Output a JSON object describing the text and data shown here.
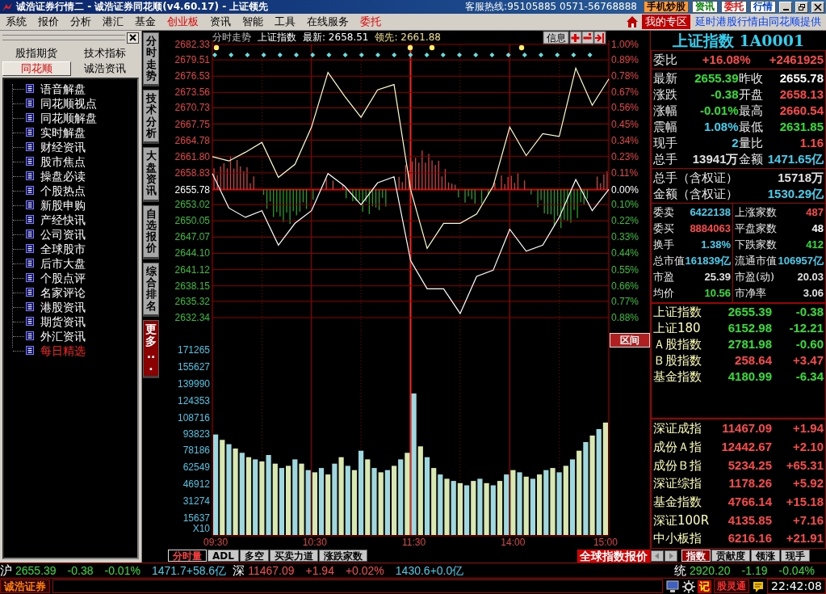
{
  "title_bar": {
    "title": "诚浩证券行情二 - 诚浩证券同花顺(v4.60.17) - 上证领先",
    "hotline": "客服热线:95105885 0571-56768888",
    "buttons": [
      {
        "label": "手机炒股",
        "kind": "filled",
        "color": "#ff9933"
      },
      {
        "label": "资讯",
        "kind": "outline",
        "color": "#008000"
      },
      {
        "label": "委托",
        "kind": "outline",
        "color": "#e00000"
      },
      {
        "label": "行情",
        "kind": "outline",
        "color": "#0040c0"
      }
    ]
  },
  "menu": {
    "items": [
      {
        "label": "系统",
        "highlighted": false
      },
      {
        "label": "报价",
        "highlighted": false
      },
      {
        "label": "分析",
        "highlighted": false
      },
      {
        "label": "港汇",
        "highlighted": false
      },
      {
        "label": "基金",
        "highlighted": false
      },
      {
        "label": "创业板",
        "highlighted": true
      },
      {
        "label": "资讯",
        "highlighted": false
      },
      {
        "label": "智能",
        "highlighted": false
      },
      {
        "label": "工具",
        "highlighted": false
      },
      {
        "label": "在线服务",
        "highlighted": false
      },
      {
        "label": "委托",
        "highlighted": true
      }
    ],
    "my_zone": "我的专区",
    "notice": "延时港股行情由同花顺提供"
  },
  "left_panel": {
    "tabs": [
      {
        "label": "股指期货",
        "selected": false
      },
      {
        "label": "技术指标",
        "selected": false
      },
      {
        "label": "同花顺",
        "selected": true
      },
      {
        "label": "诚浩资讯",
        "selected": false
      }
    ],
    "tree": [
      {
        "label": "语音解盘",
        "highlighted": false
      },
      {
        "label": "同花顺视点",
        "highlighted": false
      },
      {
        "label": "同花顺解盘",
        "highlighted": false
      },
      {
        "label": "实时解盘",
        "highlighted": false
      },
      {
        "label": "财经资讯",
        "highlighted": false
      },
      {
        "label": "股市焦点",
        "highlighted": false
      },
      {
        "label": "操盘必读",
        "highlighted": false
      },
      {
        "label": "个股热点",
        "highlighted": false
      },
      {
        "label": "新股申购",
        "highlighted": false
      },
      {
        "label": "产经快讯",
        "highlighted": false
      },
      {
        "label": "公司资讯",
        "highlighted": false
      },
      {
        "label": "全球股市",
        "highlighted": false
      },
      {
        "label": "后市大盘",
        "highlighted": false
      },
      {
        "label": "个股点评",
        "highlighted": false
      },
      {
        "label": "名家评论",
        "highlighted": false
      },
      {
        "label": "港股资讯",
        "highlighted": false
      },
      {
        "label": "期货资讯",
        "highlighted": false
      },
      {
        "label": "外汇资讯",
        "highlighted": false
      },
      {
        "label": "每日精选",
        "highlighted": true
      }
    ]
  },
  "side_tabs": [
    {
      "label": "分时走势",
      "highlighted": false
    },
    {
      "label": "技术分析",
      "highlighted": false
    },
    {
      "label": "大盘资讯",
      "highlighted": false
    },
    {
      "label": "自选报价",
      "highlighted": false
    },
    {
      "label": "综合排名",
      "highlighted": false
    },
    {
      "label": "更多...",
      "highlighted": true
    }
  ],
  "price_chart": {
    "header": {
      "view": "分时走势",
      "name": "上证指数",
      "latest": "最新: 2658.51",
      "lead": "领先: 2661.88"
    },
    "info_button": "信息",
    "baseline": "2655.78",
    "right_axis_labels": [
      "1.00%",
      "0.89%",
      "0.78%",
      "0.67%",
      "0.56%",
      "0.45%",
      "0.34%",
      "0.23%",
      "0.11%",
      "0.00%",
      "0.10%",
      "0.22%",
      "0.33%",
      "0.44%",
      "0.55%",
      "0.66%",
      "0.77%",
      "0.88%"
    ],
    "chart_data": {
      "type": "line",
      "grid": true,
      "categories": [
        null,
        null,
        null,
        null,
        null,
        null,
        null,
        null,
        null,
        null,
        null,
        null,
        null,
        null,
        null,
        null,
        null,
        null,
        null,
        null,
        null,
        null,
        null,
        null,
        null
      ],
      "ylim": [
        2632.34,
        2682.33
      ],
      "series": [
        {
          "color": "#ffffc8",
          "values": [
            2661.8,
            2661.0,
            2662.6,
            2664.4,
            2658.0,
            2660.4,
            2667.2,
            2677.2,
            2672.9,
            2669.0,
            2674.0,
            2675.0,
            2655.8,
            2645.0,
            2649.6,
            2649.6,
            2651.3,
            2656.4,
            2667.2,
            2662.0,
            2666.0,
            2665.5,
            2678.0,
            2671.2,
            2676.0
          ]
        },
        {
          "color": "#ffffff",
          "values": [
            2658.7,
            2652.4,
            2650.7,
            2651.9,
            2645.6,
            2649.6,
            2651.9,
            2658.7,
            2656.4,
            2653.0,
            2657.0,
            2658.1,
            2642.8,
            2637.6,
            2637.6,
            2633.1,
            2639.9,
            2641.0,
            2648.5,
            2644.5,
            2645.6,
            2650.7,
            2657.6,
            2651.9,
            2655.8
          ]
        }
      ],
      "yticks": [
        {
          "value": 2682.33,
          "label": "2682.33"
        },
        {
          "value": 2679.51,
          "label": "2679.51"
        },
        {
          "value": 2676.53,
          "label": "2676.53"
        },
        {
          "value": 2673.56,
          "label": "2673.56"
        },
        {
          "value": 2670.73,
          "label": "2670.73"
        },
        {
          "value": 2667.75,
          "label": "2667.75"
        },
        {
          "value": 2664.78,
          "label": "2664.78"
        },
        {
          "value": 2661.8,
          "label": "2661.80"
        },
        {
          "value": 2658.83,
          "label": "2658.83"
        },
        {
          "value": 2653.02,
          "label": "2653.02"
        },
        {
          "value": 2650.05,
          "label": "2650.05"
        },
        {
          "value": 2647.07,
          "label": "2647.07"
        },
        {
          "value": 2644.1,
          "label": "2644.10"
        },
        {
          "value": 2641.12,
          "label": "2641.12"
        },
        {
          "value": 2638.15,
          "label": "2638.15"
        },
        {
          "value": 2635.32,
          "label": "2635.32"
        },
        {
          "value": 2632.34,
          "label": "2632.34"
        }
      ]
    }
  },
  "range_button": "区间",
  "volume_chart": {
    "unit_label": "X10",
    "chart_data": {
      "type": "bar",
      "grid": true,
      "ylim": [
        0,
        187646
      ],
      "categories": [
        "09:30",
        null,
        null,
        null,
        null,
        null,
        null,
        null,
        null,
        null,
        null,
        null,
        null,
        null,
        null,
        "10:30",
        null,
        null,
        null,
        null,
        null,
        null,
        null,
        null,
        null,
        null,
        null,
        null,
        null,
        null,
        "11:30",
        null,
        null,
        null,
        null,
        null,
        null,
        null,
        null,
        null,
        null,
        null,
        null,
        null,
        null,
        "14:00",
        null,
        null,
        null,
        null,
        null,
        null,
        null,
        null,
        null,
        null,
        null,
        null,
        null,
        "15:00"
      ],
      "values": [
        93000,
        88000,
        84000,
        80000,
        76000,
        72000,
        70000,
        68000,
        74000,
        66000,
        62000,
        64000,
        70000,
        66000,
        60000,
        58000,
        62000,
        56000,
        66000,
        72000,
        64000,
        60000,
        78000,
        70000,
        62000,
        58000,
        60000,
        64000,
        70000,
        76000,
        131000,
        82000,
        72000,
        62000,
        56000,
        52000,
        50000,
        48000,
        46000,
        50000,
        52000,
        48000,
        46000,
        50000,
        56000,
        60000,
        58000,
        54000,
        52000,
        56000,
        60000,
        62000,
        58000,
        64000,
        70000,
        78000,
        86000,
        92000,
        98000,
        104000
      ],
      "yticks": [
        171265,
        155627,
        139990,
        124353,
        108716,
        93823,
        78186,
        62549,
        46912,
        31274,
        15637
      ]
    }
  },
  "chart_tabs": [
    {
      "label": "分时量",
      "selected": true
    },
    {
      "label": "ADL",
      "selected": false
    },
    {
      "label": "多空",
      "selected": false
    },
    {
      "label": "买卖力道",
      "selected": false
    },
    {
      "label": "涨跌家数",
      "selected": false
    }
  ],
  "global_index_label": "全球指数报价",
  "right_panel": {
    "title": "上证指数 1A0001",
    "order_ratio": {
      "label": "委比",
      "value": "+16.08%",
      "diff": "+2461925",
      "color": "#ff4848"
    },
    "quote": [
      {
        "cells": [
          {
            "label": "最新",
            "text": "2655.39",
            "color": "#30e030"
          },
          {
            "label": "昨收",
            "text": "2655.78",
            "color": "#ffffff"
          }
        ]
      },
      {
        "cells": [
          {
            "label": "涨跌",
            "text": "-0.38",
            "color": "#30e030"
          },
          {
            "label": "开盘",
            "text": "2658.13",
            "color": "#ff4848"
          }
        ]
      },
      {
        "cells": [
          {
            "label": "涨幅",
            "text": "-0.01%",
            "color": "#30e030"
          },
          {
            "label": "最高",
            "text": "2660.54",
            "color": "#ff4848"
          }
        ]
      },
      {
        "cells": [
          {
            "label": "震幅",
            "text": "1.08%",
            "color": "#40d0f0"
          },
          {
            "label": "最低",
            "text": "2631.85",
            "color": "#30e030"
          }
        ]
      },
      {
        "cells": [
          {
            "label": "现手",
            "text": "2",
            "color": "#40d0f0"
          },
          {
            "label": "量比",
            "text": "1.16",
            "color": "#ff4848"
          }
        ]
      },
      {
        "cells": [
          {
            "label": "总手",
            "text": "13941万",
            "color": "#e0e0e0"
          },
          {
            "label": "金额",
            "text": "1471.65亿",
            "color": "#40d0f0"
          }
        ]
      }
    ],
    "warrants": [
      {
        "label": "总手（含权证）",
        "text": "15718万",
        "color": "#e0e0e0"
      },
      {
        "label": "金额（含权证）",
        "text": "1530.29亿",
        "color": "#40d0f0"
      }
    ],
    "breadth_left": [
      {
        "label": "委卖",
        "text": "6422138",
        "color": "#40d0f0"
      },
      {
        "label": "委买",
        "text": "8884063",
        "color": "#ff4848"
      },
      {
        "label": "换手",
        "text": "1.38%",
        "color": "#40d0f0"
      },
      {
        "label": "总市值",
        "text": "161839亿",
        "color": "#40d0f0"
      },
      {
        "label": "市盈",
        "text": "25.39",
        "color": "#e0e0e0"
      },
      {
        "label": "均价",
        "text": "10.56",
        "color": "#30e030"
      }
    ],
    "breadth_right": [
      {
        "label": "上涨家数",
        "text": "487",
        "color": "#ff4848"
      },
      {
        "label": "平盘家数",
        "text": "48",
        "color": "#ffffff"
      },
      {
        "label": "下跌家数",
        "text": "412",
        "color": "#30e030"
      },
      {
        "label": "流通市值",
        "text": "106957亿",
        "color": "#40d0f0"
      },
      {
        "label": "市盈(动)",
        "text": "20.03",
        "color": "#e0e0e0"
      },
      {
        "label": "市净率",
        "text": "3.06",
        "color": "#e0e0e0"
      }
    ],
    "sh_indices": [
      {
        "name": "上证指数",
        "value": "2655.39",
        "change": "-0.38",
        "color": "#30e030"
      },
      {
        "name": "上证180",
        "value": "6152.98",
        "change": "-12.21",
        "color": "#30e030"
      },
      {
        "name": "Ａ股指数",
        "value": "2781.98",
        "change": "-0.60",
        "color": "#30e030"
      },
      {
        "name": "Ｂ股指数",
        "value": "258.64",
        "change": "+3.47",
        "color": "#ff4848"
      },
      {
        "name": "基金指数",
        "value": "4180.99",
        "change": "-6.34",
        "color": "#30e030"
      }
    ],
    "sz_indices": [
      {
        "name": "深证成指",
        "value": "11467.09",
        "change": "+1.94",
        "color": "#ff4848"
      },
      {
        "name": "成份Ａ指",
        "value": "12442.67",
        "change": "+2.10",
        "color": "#ff4848"
      },
      {
        "name": "成份Ｂ指",
        "value": "5234.25",
        "change": "+65.31",
        "color": "#ff4848"
      },
      {
        "name": "深证综指",
        "value": "1178.26",
        "change": "+5.92",
        "color": "#ff4848"
      },
      {
        "name": "基金指数",
        "value": "4766.14",
        "change": "+15.18",
        "color": "#ff4848"
      },
      {
        "name": "深证100R",
        "value": "4135.85",
        "change": "+7.16",
        "color": "#ff4848"
      },
      {
        "name": "中小板指",
        "value": "6216.16",
        "change": "+21.91",
        "color": "#ff4848"
      }
    ]
  },
  "right_tabs": [
    {
      "label": "指数",
      "selected": true
    },
    {
      "label": "贡献度",
      "selected": false
    },
    {
      "label": "领涨",
      "selected": false
    },
    {
      "label": "现手",
      "selected": false
    }
  ],
  "status_bar": {
    "quotes": [
      {
        "market": "沪",
        "items": [
          {
            "text": "2655.39",
            "color": "#30e030"
          },
          {
            "text": "-0.38",
            "color": "#30e030"
          },
          {
            "text": "-0.01%",
            "color": "#30e030"
          },
          {
            "text": "1471.7+58.6亿",
            "color": "#40d0f0"
          }
        ]
      },
      {
        "market": "深",
        "items": [
          {
            "text": "11467.09",
            "color": "#ff4848"
          },
          {
            "text": "+1.94",
            "color": "#ff4848"
          },
          {
            "text": "+0.02%",
            "color": "#ff4848"
          },
          {
            "text": "1430.6+0.0亿",
            "color": "#40d0f0"
          }
        ]
      }
    ],
    "side_quote": {
      "market": "统",
      "items": [
        {
          "text": "2920.20",
          "color": "#30e030"
        },
        {
          "text": "-1.19",
          "color": "#30e030"
        },
        {
          "text": "-0.04%",
          "color": "#30e030"
        }
      ]
    },
    "broker": "诚浩证券",
    "memo": "记",
    "app": "股灵通",
    "time": "22:42:08"
  }
}
